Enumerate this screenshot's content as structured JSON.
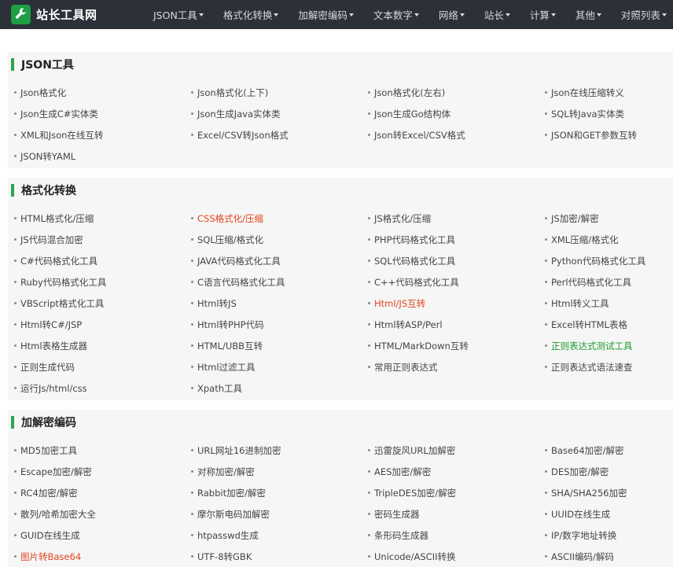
{
  "header": {
    "site_title": "站长工具网",
    "nav": [
      "JSON工具",
      "格式化转换",
      "加解密编码",
      "文本数字",
      "网络",
      "站长",
      "计算",
      "其他",
      "对照列表"
    ]
  },
  "sections": [
    {
      "title": "JSON工具",
      "items": [
        {
          "label": "Json格式化"
        },
        {
          "label": " Json格式化(上下)"
        },
        {
          "label": "Json格式化(左右)"
        },
        {
          "label": "Json在线压缩转义"
        },
        {
          "label": "Json生成C#实体类"
        },
        {
          "label": " Json生成Java实体类"
        },
        {
          "label": "Json生成Go结构体"
        },
        {
          "label": "SQL转Java实体类"
        },
        {
          "label": "XML和Json在线互转"
        },
        {
          "label": "Excel/CSV转Json格式"
        },
        {
          "label": "Json转Excel/CSV格式"
        },
        {
          "label": "JSON和GET参数互转"
        },
        {
          "label": "JSON转YAML"
        }
      ]
    },
    {
      "title": "格式化转换",
      "items": [
        {
          "label": "HTML格式化/压缩"
        },
        {
          "label": " CSS格式化/压缩",
          "style": "hot"
        },
        {
          "label": "JS格式化/压缩"
        },
        {
          "label": "JS加密/解密"
        },
        {
          "label": " JS代码混合加密"
        },
        {
          "label": "SQL压缩/格式化"
        },
        {
          "label": "PHP代码格式化工具"
        },
        {
          "label": "XML压缩/格式化"
        },
        {
          "label": "C#代码格式化工具"
        },
        {
          "label": "JAVA代码格式化工具"
        },
        {
          "label": "SQL代码格式化工具"
        },
        {
          "label": "Python代码格式化工具"
        },
        {
          "label": "Ruby代码格式化工具"
        },
        {
          "label": "C语言代码格式化工具"
        },
        {
          "label": "C++代码格式化工具"
        },
        {
          "label": "Perl代码格式化工具"
        },
        {
          "label": "VBScript格式化工具"
        },
        {
          "label": " Html转JS"
        },
        {
          "label": "Html/JS互转",
          "style": "hot"
        },
        {
          "label": " Html转义工具"
        },
        {
          "label": " Html转C#/JSP"
        },
        {
          "label": "Html转PHP代码"
        },
        {
          "label": "Html转ASP/Perl"
        },
        {
          "label": "Excel转HTML表格"
        },
        {
          "label": "Html表格生成器"
        },
        {
          "label": "HTML/UBB互转"
        },
        {
          "label": "HTML/MarkDown互转"
        },
        {
          "label": "正则表达式测试工具",
          "style": "green"
        },
        {
          "label": "正则生成代码"
        },
        {
          "label": "Html过滤工具"
        },
        {
          "label": "常用正则表达式"
        },
        {
          "label": "正则表达式语法速查"
        },
        {
          "label": "运行Js/html/css"
        },
        {
          "label": "Xpath工具"
        }
      ]
    },
    {
      "title": "加解密编码",
      "items": [
        {
          "label": "MD5加密工具"
        },
        {
          "label": "URL网址16进制加密"
        },
        {
          "label": "迅雷旋风URL加解密"
        },
        {
          "label": " Base64加密/解密"
        },
        {
          "label": "Escape加密/解密"
        },
        {
          "label": "对称加密/解密"
        },
        {
          "label": "AES加密/解密"
        },
        {
          "label": "DES加密/解密"
        },
        {
          "label": "RC4加密/解密"
        },
        {
          "label": "Rabbit加密/解密"
        },
        {
          "label": "TripleDES加密/解密"
        },
        {
          "label": "SHA/SHA256加密"
        },
        {
          "label": "散列/哈希加密大全"
        },
        {
          "label": "摩尔斯电码加解密"
        },
        {
          "label": "密码生成器"
        },
        {
          "label": "UUID在线生成"
        },
        {
          "label": "GUID在线生成"
        },
        {
          "label": "htpasswd生成"
        },
        {
          "label": "条形码生成器"
        },
        {
          "label": "IP/数字地址转换"
        },
        {
          "label": " 图片转Base64",
          "style": "hot"
        },
        {
          "label": "UTF-8转GBK"
        },
        {
          "label": "Unicode/ASCII转换"
        },
        {
          "label": "ASCII编码/解码"
        }
      ]
    }
  ]
}
